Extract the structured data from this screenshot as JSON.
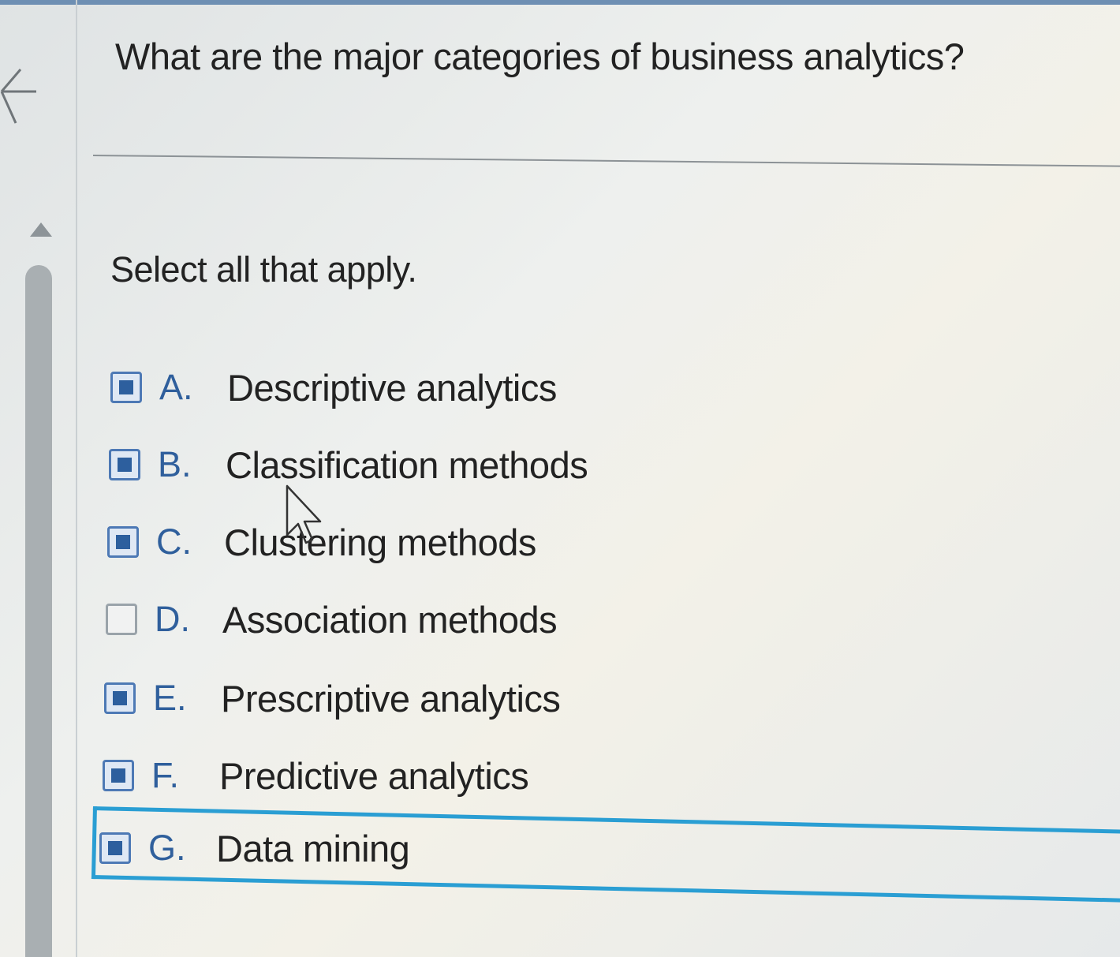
{
  "question": {
    "text": "What are the major categories of business analytics?"
  },
  "instruction": "Select all that apply.",
  "options": [
    {
      "letter": "A.",
      "label": "Descriptive analytics",
      "checked": true
    },
    {
      "letter": "B.",
      "label": "Classification methods",
      "checked": true
    },
    {
      "letter": "C.",
      "label": "Clustering methods",
      "checked": true
    },
    {
      "letter": "D.",
      "label": "Association methods",
      "checked": false
    },
    {
      "letter": "E.",
      "label": "Prescriptive analytics",
      "checked": true
    },
    {
      "letter": "F.",
      "label": "Predictive analytics",
      "checked": true
    },
    {
      "letter": "G.",
      "label": "Data mining",
      "checked": true,
      "focused": true
    }
  ],
  "icons": {
    "back": "back-arrow-icon",
    "scroll_up": "scroll-up-icon",
    "cursor": "mouse-pointer-icon"
  },
  "colors": {
    "checkbox_border": "#4d79b5",
    "checkbox_fill": "#2d5f9e",
    "letter": "#2f5f9c",
    "focus_ring": "#2a9ed3",
    "scrollbar": "#a9afb2"
  }
}
